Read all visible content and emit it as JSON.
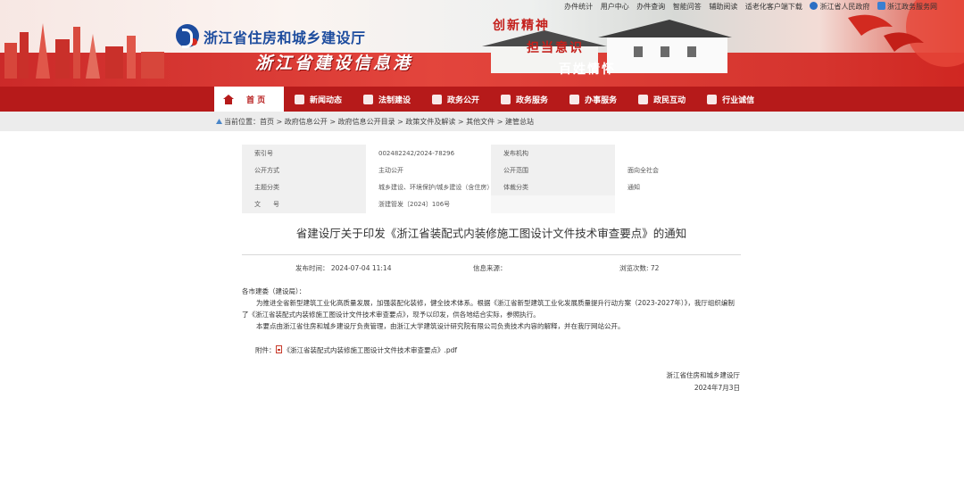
{
  "header": {
    "top_links": [
      "办件统计",
      "用户中心",
      "办件查询",
      "智能问答",
      "辅助阅读",
      "适老化客户端下载",
      "浙江省人民政府",
      "浙江政务服务网"
    ],
    "dept_name": "浙江省住房和城乡建设厅",
    "site_name": "浙江省建设信息港",
    "slogans": [
      "创新精神",
      "担当意识",
      "百姓情怀"
    ]
  },
  "nav": {
    "items": [
      {
        "label": "首 页",
        "icon": "home-icon"
      },
      {
        "label": "新闻动态",
        "icon": "news-icon"
      },
      {
        "label": "法制建设",
        "icon": "law-icon"
      },
      {
        "label": "政务公开",
        "icon": "gov-info-icon"
      },
      {
        "label": "政务服务",
        "icon": "gov-service-icon"
      },
      {
        "label": "办事服务",
        "icon": "affairs-icon"
      },
      {
        "label": "政民互动",
        "icon": "interaction-icon"
      },
      {
        "label": "行业诚信",
        "icon": "credit-icon"
      }
    ]
  },
  "breadcrumb": {
    "prefix": "当前位置：",
    "path": "首页 > 政府信息公开 > 政府信息公开目录 > 政策文件及解读 > 其他文件 > 建管总站"
  },
  "meta": {
    "index_label": "索引号",
    "index_value": "002482242/2024-78296",
    "issuer_label": "发布机构",
    "issuer_value": "",
    "open_mode_label": "公开方式",
    "open_mode_value": "主动公开",
    "open_scope_label": "公开范围",
    "open_scope_value": "面向全社会",
    "topic_label": "主题分类",
    "topic_value": "城乡建设、环境保护/城乡建设（含住房）",
    "genre_label": "体裁分类",
    "genre_value": "通知",
    "docno_label": "文　　号",
    "docno_value": "浙建管发〔2024〕106号"
  },
  "article": {
    "title": "省建设厅关于印发《浙江省装配式内装修施工图设计文件技术审查要点》的通知",
    "publish_time": "发布时间：  2024-07-04 11:14",
    "source": "信息来源：",
    "views": "浏览次数: 72",
    "salutation": "各市建委（建设局）：",
    "para1": "为推进全省新型建筑工业化高质量发展，加强装配化装修，健全技术体系。根据《浙江省新型建筑工业化发展质量提升行动方案（2023-2027年）》，我厅组织编制了《浙江省装配式内装修施工图设计文件技术审查要点》，现予以印发，供各地结合实际，参照执行。",
    "para2": "本要点由浙江省住房和城乡建设厅负责管理，由浙江大学建筑设计研究院有限公司负责技术内容的解释，并在我厅网站公开。",
    "attachment_label": "附件：",
    "attachment_name": "《浙江省装配式内装修施工图设计文件技术审查要点》.pdf",
    "signature": "浙江省住房和城乡建设厅",
    "date": "2024年7月3日"
  }
}
